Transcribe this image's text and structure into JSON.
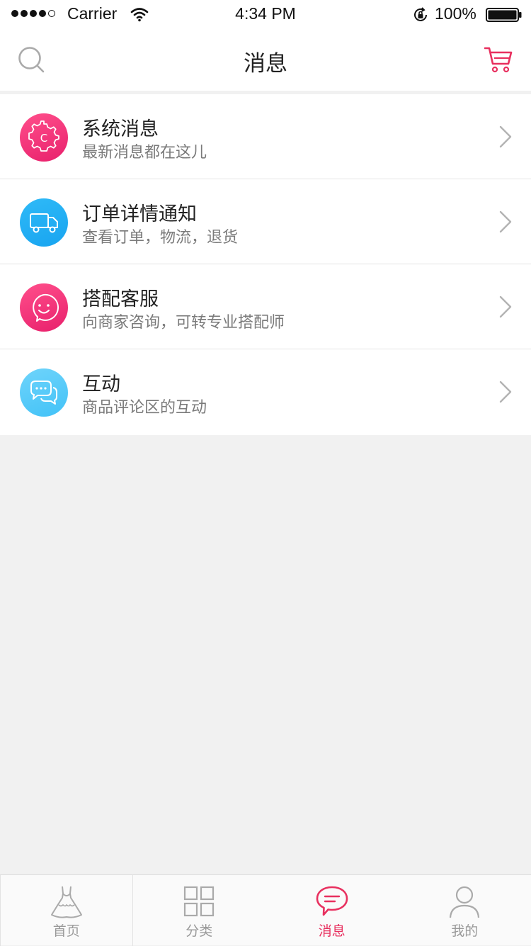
{
  "status_bar": {
    "carrier": "Carrier",
    "time": "4:34 PM",
    "battery": "100%",
    "signal_bars_filled": 4,
    "signal_bars_total": 5
  },
  "nav": {
    "title": "消息",
    "left_icon": "search-icon",
    "right_icon": "cart-icon"
  },
  "colors": {
    "accent": "#e8305f",
    "pink_gradient": [
      "#ff4f8b",
      "#e8206c"
    ],
    "blue_gradient": [
      "#2fbaf7",
      "#18a4f0"
    ],
    "light_blue_gradient": [
      "#6fd4fb",
      "#42c2f7"
    ]
  },
  "messages": [
    {
      "title": "系统消息",
      "subtitle": "最新消息都在这儿",
      "icon": "gear-icon"
    },
    {
      "title": "订单详情通知",
      "subtitle": "查看订单，物流，退货",
      "icon": "truck-icon"
    },
    {
      "title": "搭配客服",
      "subtitle": "向商家咨询，可转专业搭配师",
      "icon": "service-face-icon"
    },
    {
      "title": "互动",
      "subtitle": "商品评论区的互动",
      "icon": "chat-bubbles-icon"
    }
  ],
  "tabs": [
    {
      "label": "首页",
      "icon": "dress-icon",
      "active": false
    },
    {
      "label": "分类",
      "icon": "grid-icon",
      "active": false
    },
    {
      "label": "消息",
      "icon": "message-icon",
      "active": true
    },
    {
      "label": "我的",
      "icon": "user-icon",
      "active": false
    }
  ]
}
